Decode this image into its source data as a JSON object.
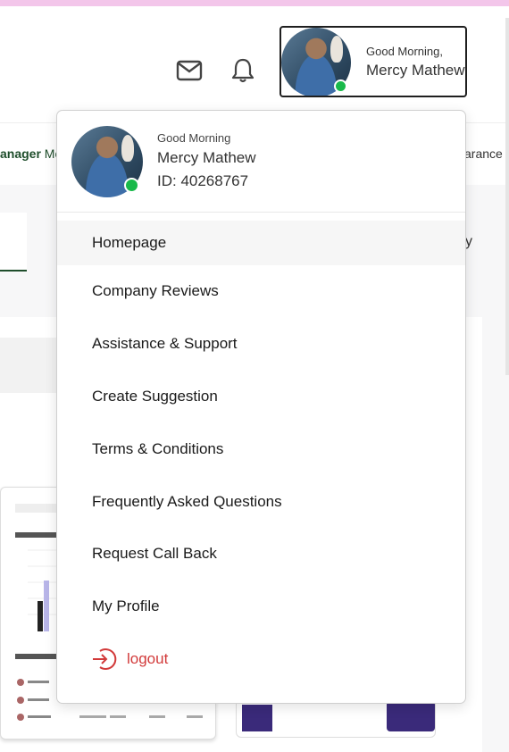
{
  "header": {
    "icons": {
      "mail": "mail-icon",
      "bell": "bell-icon"
    },
    "profile": {
      "greeting": "Good Morning,",
      "name": "Mercy Mathew"
    }
  },
  "subnav": {
    "left_bold": "anager",
    "left_rest": " Mo",
    "right_text": "arance"
  },
  "background": {
    "right_letter": "y"
  },
  "dropdown": {
    "greeting": "Good Morning",
    "name": "Mercy Mathew",
    "id": "ID: 40268767",
    "items": [
      {
        "label": "Homepage"
      },
      {
        "label": "Company Reviews"
      },
      {
        "label": "Assistance & Support"
      },
      {
        "label": "Create Suggestion"
      },
      {
        "label": "Terms & Conditions"
      },
      {
        "label": "Frequently Asked Questions"
      },
      {
        "label": "Request Call Back"
      },
      {
        "label": "My Profile"
      }
    ],
    "logout": {
      "label": "logout",
      "icon": "logout-icon"
    }
  },
  "colors": {
    "status_online": "#19b94a",
    "logout": "#d23a3a",
    "brand_green": "#1e4d2b",
    "top_strip": "#f3c6ea"
  }
}
